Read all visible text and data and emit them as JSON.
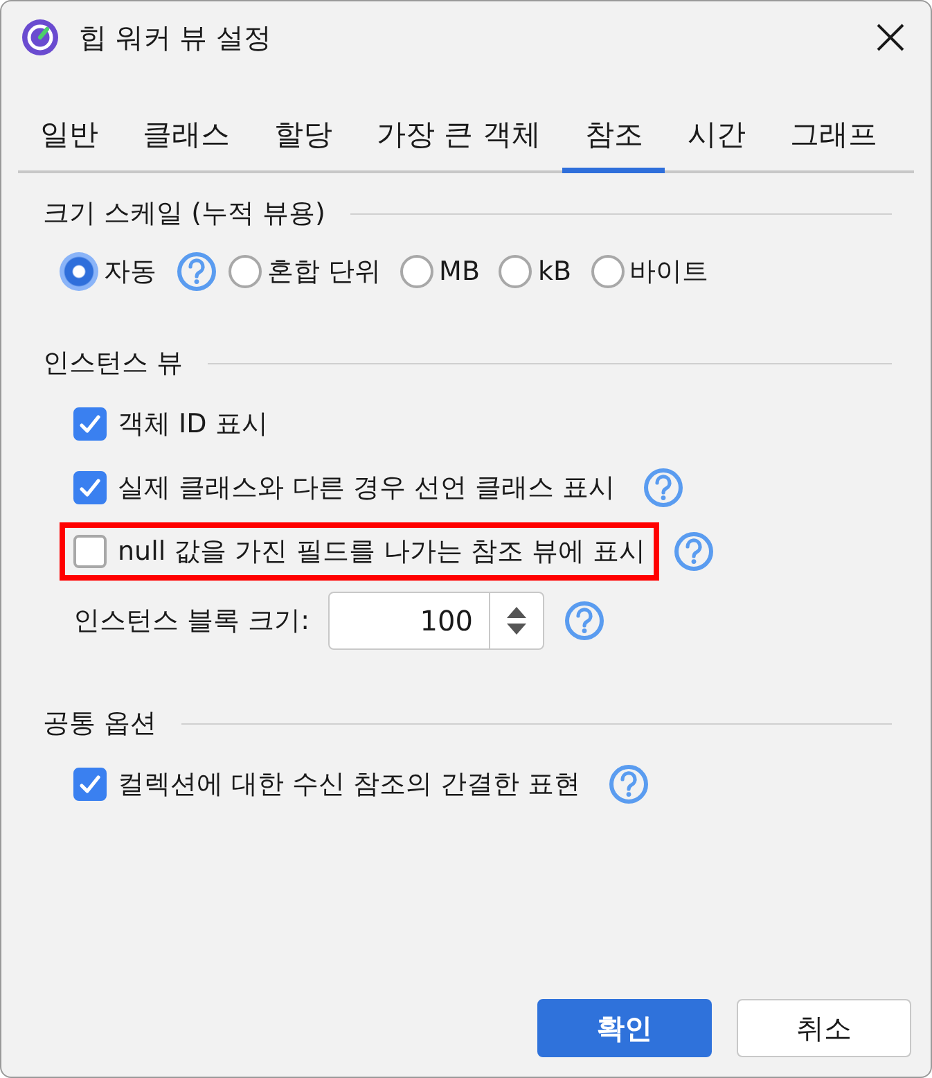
{
  "window": {
    "title": "힙 워커 뷰 설정"
  },
  "tabs": [
    {
      "label": "일반",
      "selected": false
    },
    {
      "label": "클래스",
      "selected": false
    },
    {
      "label": "할당",
      "selected": false
    },
    {
      "label": "가장 큰 객체",
      "selected": false
    },
    {
      "label": "참조",
      "selected": true
    },
    {
      "label": "시간",
      "selected": false
    },
    {
      "label": "그래프",
      "selected": false
    }
  ],
  "sections": [
    {
      "title": "크기 스케일 (누적 뷰용)",
      "radios": [
        {
          "label": "자동",
          "selected": true,
          "help": true
        },
        {
          "label": "혼합 단위",
          "selected": false,
          "help": false
        },
        {
          "label": "MB",
          "selected": false,
          "help": false
        },
        {
          "label": "kB",
          "selected": false,
          "help": false
        },
        {
          "label": "바이트",
          "selected": false,
          "help": false
        }
      ]
    },
    {
      "title": "인스턴스 뷰",
      "options": [
        {
          "kind": "checkbox",
          "label": "객체 ID 표시",
          "checked": true,
          "help": false,
          "highlighted": false
        },
        {
          "kind": "checkbox",
          "label": "실제 클래스와 다른 경우 선언 클래스 표시",
          "checked": true,
          "help": true,
          "highlighted": false
        },
        {
          "kind": "checkbox",
          "label": "null 값을 가진 필드를 나가는 참조 뷰에 표시",
          "checked": false,
          "help": true,
          "highlighted": true
        },
        {
          "kind": "spinner",
          "label": "인스턴스 블록 크기:",
          "value": "100",
          "help": true
        }
      ]
    },
    {
      "title": "공통 옵션",
      "options": [
        {
          "kind": "checkbox",
          "label": "컬렉션에 대한 수신 참조의 간결한 표현",
          "checked": true,
          "help": true,
          "highlighted": false
        }
      ]
    }
  ],
  "buttons": [
    {
      "label": "확인",
      "kind": "primary"
    },
    {
      "label": "취소",
      "kind": "secondary"
    }
  ]
}
